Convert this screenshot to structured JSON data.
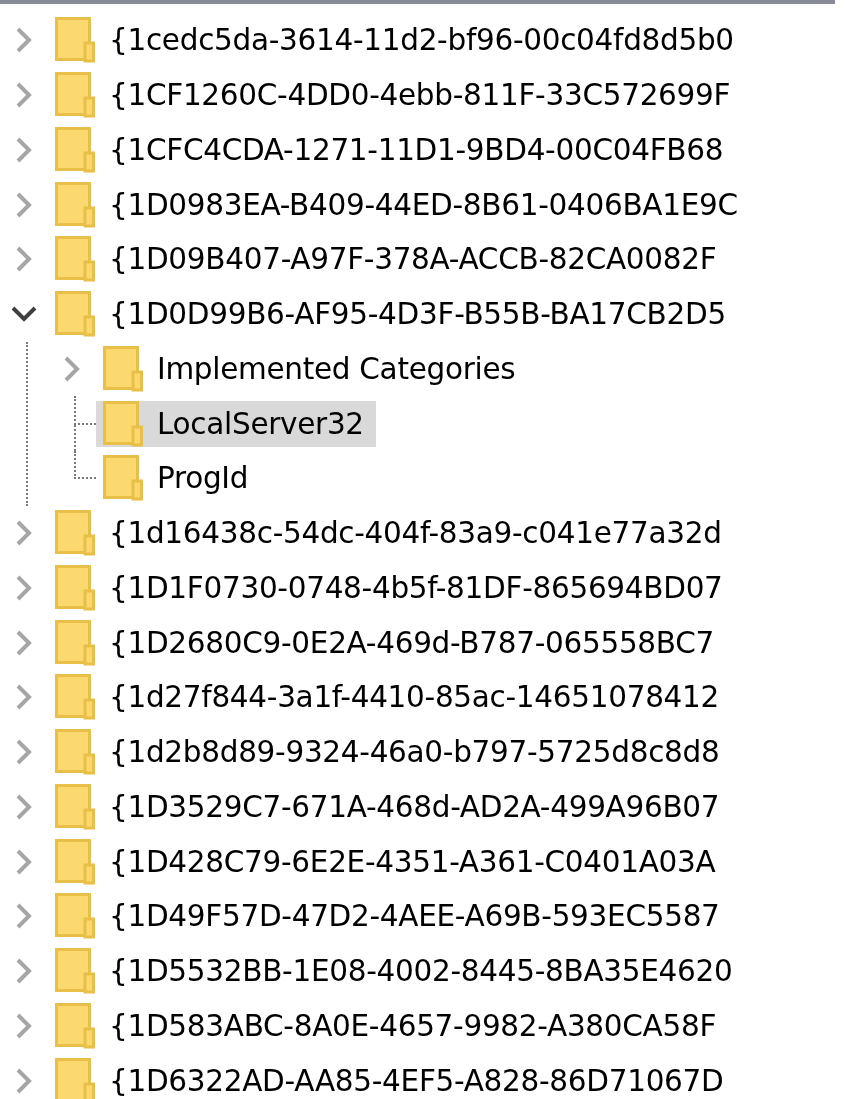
{
  "tree": {
    "items": [
      {
        "label": "{1cedc5da-3614-11d2-bf96-00c04fd8d5b0",
        "kind": "branch",
        "expanded": false,
        "selected": false
      },
      {
        "label": "{1CF1260C-4DD0-4ebb-811F-33C572699F",
        "kind": "branch",
        "expanded": false,
        "selected": false
      },
      {
        "label": "{1CFC4CDA-1271-11D1-9BD4-00C04FB68",
        "kind": "branch",
        "expanded": false,
        "selected": false
      },
      {
        "label": "{1D0983EA-B409-44ED-8B61-0406BA1E9C",
        "kind": "branch",
        "expanded": false,
        "selected": false
      },
      {
        "label": "{1D09B407-A97F-378A-ACCB-82CA0082F",
        "kind": "branch",
        "expanded": false,
        "selected": false
      },
      {
        "label": "{1D0D99B6-AF95-4D3F-B55B-BA17CB2D5",
        "kind": "branch",
        "expanded": true,
        "selected": false,
        "children": [
          {
            "label": "Implemented Categories",
            "kind": "branch",
            "expanded": false,
            "selected": false
          },
          {
            "label": "LocalServer32",
            "kind": "leaf",
            "selected": true
          },
          {
            "label": "ProgId",
            "kind": "leaf",
            "selected": false
          }
        ]
      },
      {
        "label": "{1d16438c-54dc-404f-83a9-c041e77a32d",
        "kind": "branch",
        "expanded": false,
        "selected": false
      },
      {
        "label": "{1D1F0730-0748-4b5f-81DF-865694BD07",
        "kind": "branch",
        "expanded": false,
        "selected": false
      },
      {
        "label": "{1D2680C9-0E2A-469d-B787-065558BC7",
        "kind": "branch",
        "expanded": false,
        "selected": false
      },
      {
        "label": "{1d27f844-3a1f-4410-85ac-14651078412",
        "kind": "branch",
        "expanded": false,
        "selected": false
      },
      {
        "label": "{1d2b8d89-9324-46a0-b797-5725d8c8d8",
        "kind": "branch",
        "expanded": false,
        "selected": false
      },
      {
        "label": "{1D3529C7-671A-468d-AD2A-499A96B07",
        "kind": "branch",
        "expanded": false,
        "selected": false
      },
      {
        "label": "{1D428C79-6E2E-4351-A361-C0401A03A",
        "kind": "branch",
        "expanded": false,
        "selected": false
      },
      {
        "label": "{1D49F57D-47D2-4AEE-A69B-593EC5587",
        "kind": "branch",
        "expanded": false,
        "selected": false
      },
      {
        "label": "{1D5532BB-1E08-4002-8445-8BA35E4620",
        "kind": "branch",
        "expanded": false,
        "selected": false
      },
      {
        "label": "{1D583ABC-8A0E-4657-9982-A380CA58F",
        "kind": "branch",
        "expanded": false,
        "selected": false
      },
      {
        "label": "{1D6322AD-AA85-4EF5-A828-86D71067D",
        "kind": "branch",
        "expanded": false,
        "selected": false
      }
    ]
  }
}
